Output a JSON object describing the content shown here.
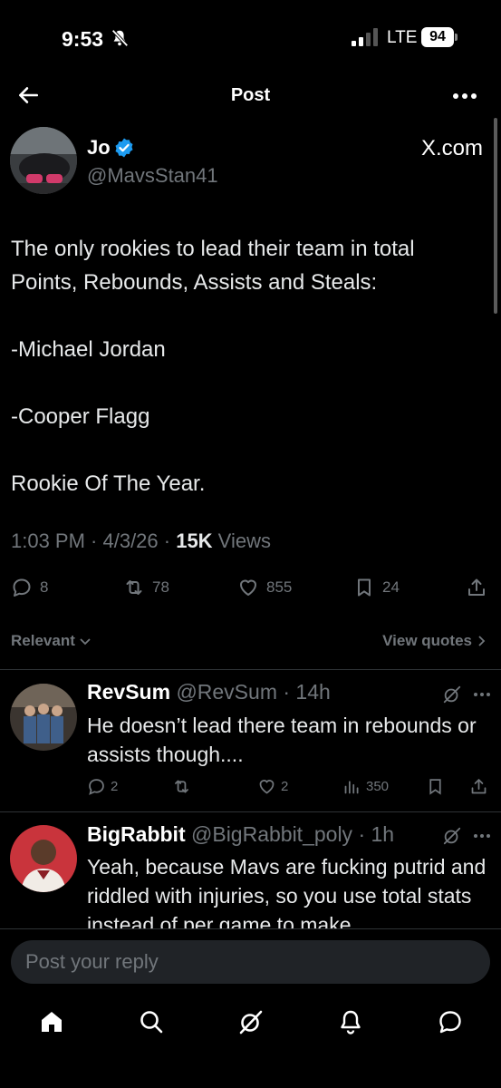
{
  "status_bar": {
    "time": "9:53",
    "network": "LTE",
    "battery": "94"
  },
  "header": {
    "title": "Post"
  },
  "post": {
    "author_name": "Jo",
    "author_handle": "@MavsStan41",
    "source": "X.com",
    "body": [
      "The only rookies to lead their team in total Points, Rebounds, Assists and Steals:",
      "",
      "-Michael Jordan",
      "",
      "-Cooper Flagg",
      "",
      "Rookie Of The Year."
    ],
    "meta_time": "1:03 PM · 4/3/26 · ",
    "views_count": "15K",
    "views_label": " Views",
    "stats": {
      "replies": "8",
      "reposts": "78",
      "likes": "855",
      "bookmarks": "24"
    }
  },
  "sort": {
    "label": "Relevant",
    "view_quotes": "View quotes"
  },
  "replies": [
    {
      "name": "RevSum",
      "handle": "@RevSum · 14h",
      "text": "He doesn’t lead there team in rebounds or assists though....",
      "replies": "2",
      "reposts": "",
      "likes": "2",
      "views": "350"
    },
    {
      "name": "BigRabbit",
      "handle": "@BigRabbit_poly · 1h",
      "text": "Yeah, because Mavs are fucking putrid and riddled with injuries, so you use total stats instead of per game to make"
    }
  ],
  "composer": {
    "placeholder": "Post your reply"
  },
  "colors": {
    "background": "#000000",
    "text": "#e7e9ea",
    "muted": "#71767b",
    "verified": "#1d9bf0",
    "divider": "#2f3336"
  }
}
